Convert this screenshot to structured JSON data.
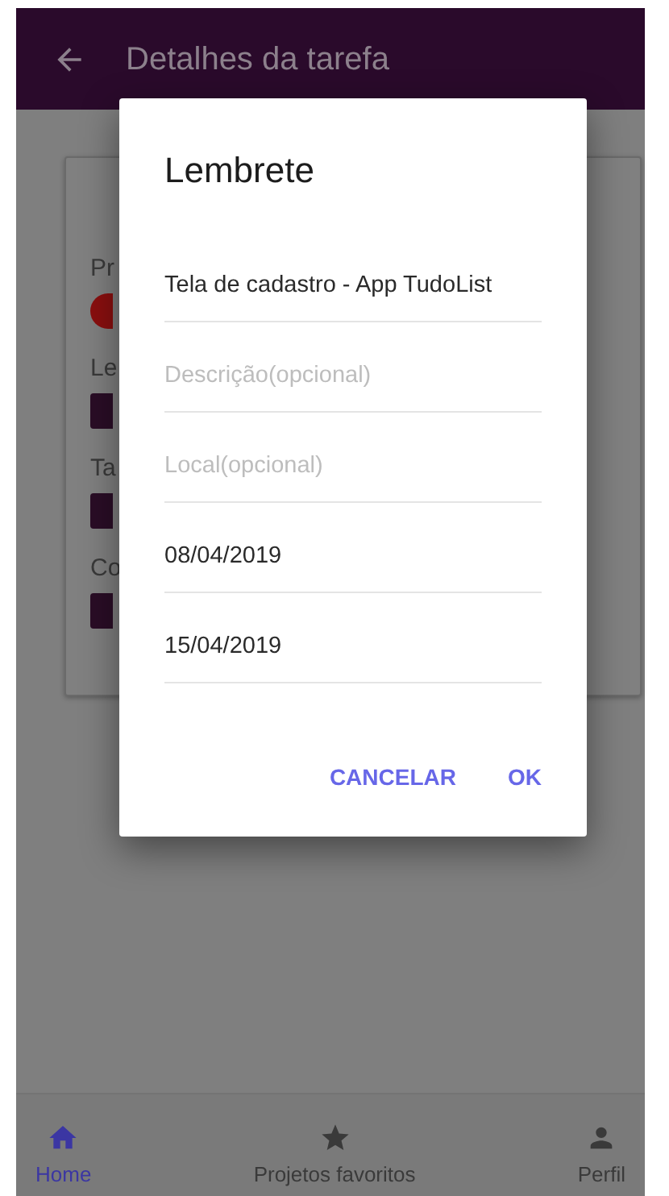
{
  "app_bar": {
    "title": "Detalhes da tarefa"
  },
  "details_card": {
    "items": [
      {
        "label": "Pr",
        "kind": "circle",
        "color": "#8a0f0f"
      },
      {
        "label": "Le",
        "kind": "square",
        "color": "#2a0d26"
      },
      {
        "label": "Ta",
        "kind": "square",
        "color": "#2a0d26"
      },
      {
        "label": "Co",
        "kind": "square",
        "color": "#2a0d26"
      }
    ]
  },
  "dialog": {
    "title": "Lembrete",
    "fields": [
      {
        "value": "Tela de cadastro - App TudoList"
      },
      {
        "placeholder": "Descrição(opcional)"
      },
      {
        "placeholder": "Local(opcional)"
      },
      {
        "value": "08/04/2019"
      },
      {
        "value": "15/04/2019"
      }
    ],
    "buttons": [
      "CANCELAR",
      "OK"
    ]
  },
  "bottom_nav": [
    {
      "label": "Home",
      "kind": "home",
      "selected": true
    },
    {
      "label": "Projetos favoritos",
      "kind": "star",
      "selected": false
    },
    {
      "label": "Perfil",
      "kind": "person",
      "selected": false
    }
  ]
}
